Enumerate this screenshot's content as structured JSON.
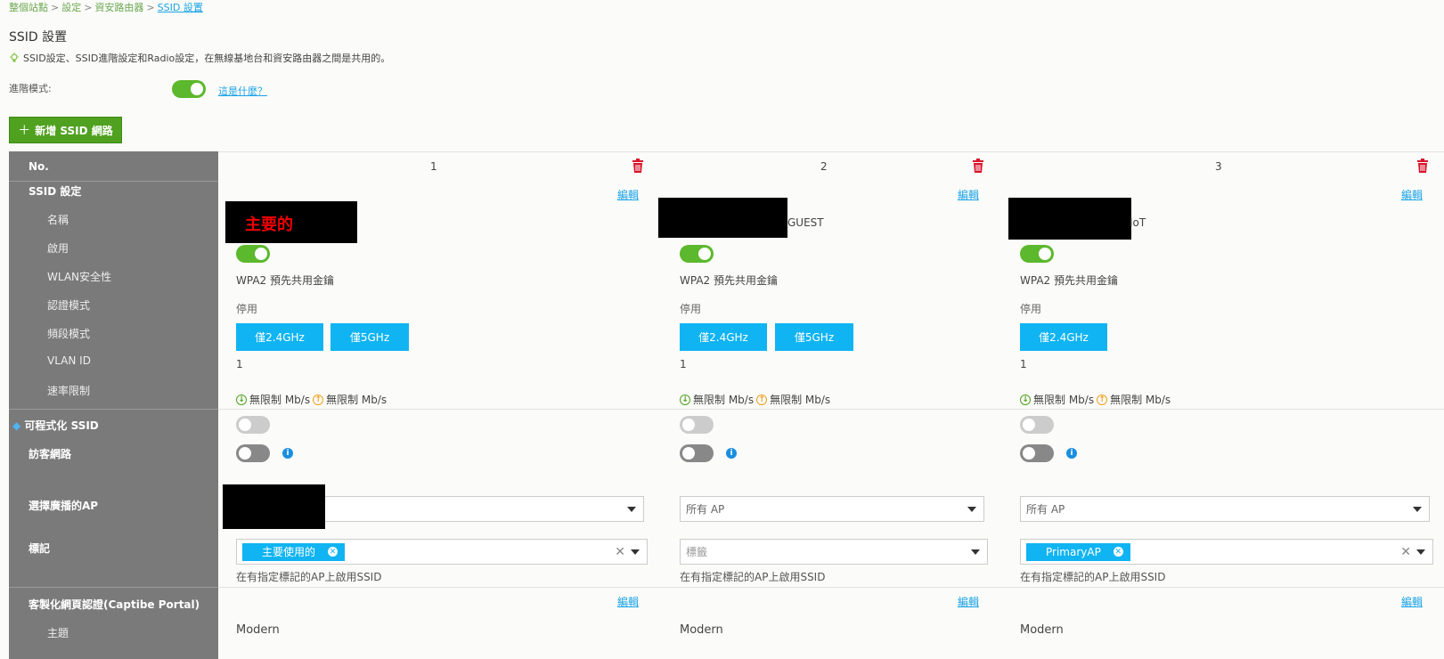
{
  "breadcrumb": [
    "整個站點",
    "設定",
    "資安路由器",
    "SSID 設置"
  ],
  "page_title": "SSID 設置",
  "hint": "SSID設定、SSID進階設定和Radio設定，在無線基地台和資安路由器之間是共用的。",
  "advanced_mode": {
    "label": "進階模式:",
    "enabled": true,
    "link": "這是什麼？"
  },
  "add_button": {
    "icon": "＋",
    "label": "新增 SSID 網路"
  },
  "sidebar": {
    "no": "No.",
    "ssid_settings": "SSID 設定",
    "name": "名稱",
    "enable": "啟用",
    "wlan_security": "WLAN安全性",
    "auth_mode": "認證模式",
    "band_mode": "頻段模式",
    "vlan_id": "VLAN ID",
    "rate_limit": "速率限制",
    "programmable_ssid": "可程式化 SSID",
    "guest_network": "訪客網路",
    "select_ap": "選擇廣播的AP",
    "tag": "標記",
    "captive_portal": "客製化網頁認證(Captibe Portal)",
    "theme": "主題"
  },
  "edit_label": "編輯",
  "columns": [
    {
      "no": "1",
      "name_visible": "主要的",
      "enabled": true,
      "security": "WPA2 預先共用金鑰",
      "auth": "停用",
      "bands": [
        "僅2.4GHz",
        "僅5GHz"
      ],
      "vlan": "1",
      "rate_down": "無限制 Mb/s",
      "rate_up": "無限制 Mb/s",
      "programmable": false,
      "guest": false,
      "ap_select": "",
      "tag_value": "主要使用的",
      "tag_placeholder": "",
      "tag_hint": "在有指定標記的AP上啟用SSID",
      "theme": "Modern"
    },
    {
      "no": "2",
      "name_visible": "GUEST",
      "enabled": true,
      "security": "WPA2 預先共用金鑰",
      "auth": "停用",
      "bands": [
        "僅2.4GHz",
        "僅5GHz"
      ],
      "vlan": "1",
      "rate_down": "無限制 Mb/s",
      "rate_up": "無限制 Mb/s",
      "programmable": false,
      "guest": false,
      "ap_select": "所有 AP",
      "tag_value": "",
      "tag_placeholder": "標籤",
      "tag_hint": "在有指定標記的AP上啟用SSID",
      "theme": "Modern"
    },
    {
      "no": "3",
      "name_visible": "IoT",
      "enabled": true,
      "security": "WPA2 預先共用金鑰",
      "auth": "停用",
      "bands": [
        "僅2.4GHz"
      ],
      "vlan": "1",
      "rate_down": "無限制 Mb/s",
      "rate_up": "無限制 Mb/s",
      "programmable": false,
      "guest": false,
      "ap_select": "所有 AP",
      "tag_value": "PrimaryAP",
      "tag_placeholder": "",
      "tag_hint": "在有指定標記的AP上啟用SSID",
      "theme": "Modern"
    }
  ],
  "colors": {
    "accent_green": "#5cb82c",
    "link_blue": "#1aa3e8",
    "band_blue": "#10b4f2",
    "trash_red": "#d9142b",
    "sidebar_gray": "#7a7a7a"
  }
}
